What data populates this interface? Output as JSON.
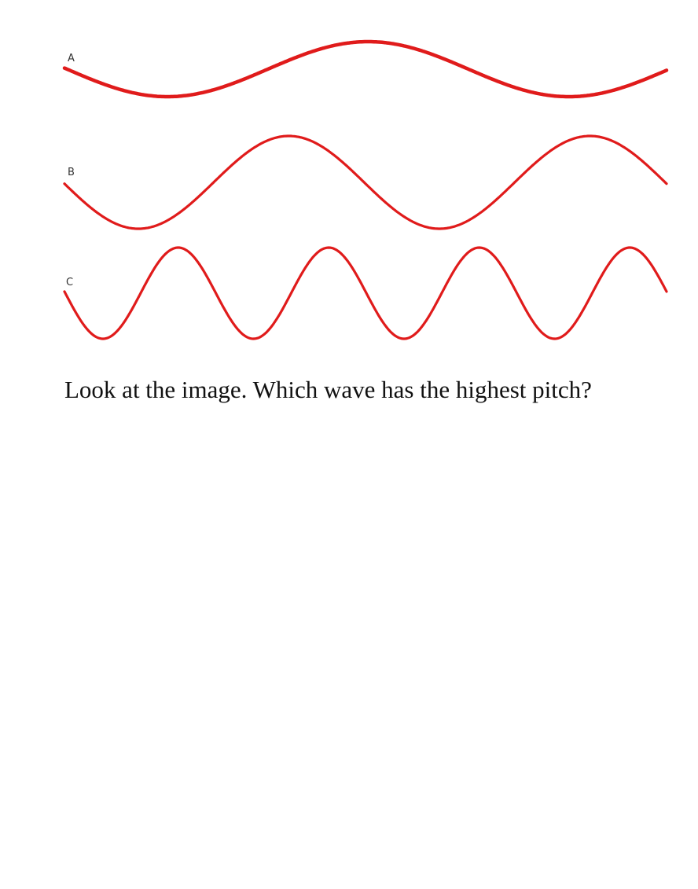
{
  "colors": {
    "wave": "#e01b1b",
    "background": "#ffffff",
    "text": "#111111"
  },
  "waves": [
    {
      "label": "A",
      "cycles": 1.5
    },
    {
      "label": "B",
      "cycles": 2
    },
    {
      "label": "C",
      "cycles": 4
    }
  ],
  "question": "Look at the image. Which wave has the highest pitch?"
}
